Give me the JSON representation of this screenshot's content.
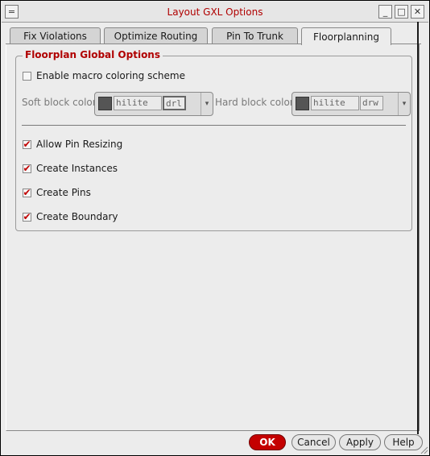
{
  "window": {
    "title": "Layout GXL Options",
    "menu_glyph": "=",
    "min_glyph": "_",
    "max_glyph": "□",
    "close_glyph": "✕"
  },
  "tabs": [
    {
      "label": "Fix Violations",
      "active": false
    },
    {
      "label": "Optimize Routing",
      "active": false
    },
    {
      "label": "Pin To Trunk",
      "active": false
    },
    {
      "label": "Floorplanning",
      "active": true
    }
  ],
  "floorplan": {
    "group_title": "Floorplan Global Options",
    "enable_macro_coloring": {
      "label": "Enable macro coloring scheme",
      "checked": false
    },
    "soft_block": {
      "label": "Soft block color",
      "layer": "hilite",
      "purpose": "drl"
    },
    "hard_block": {
      "label": "Hard block color",
      "layer": "hilite",
      "purpose": "drw"
    },
    "options": [
      {
        "label": "Allow Pin Resizing",
        "checked": true
      },
      {
        "label": "Create Instances",
        "checked": true
      },
      {
        "label": "Create Pins",
        "checked": true
      },
      {
        "label": "Create Boundary",
        "checked": true
      }
    ]
  },
  "buttons": {
    "ok": "OK",
    "cancel": "Cancel",
    "apply": "Apply",
    "help": "Help"
  },
  "colors": {
    "accent_red": "#c40000",
    "title_red": "#b00000",
    "swatch": "#555555"
  },
  "icons": {
    "check": "✔",
    "dropdown": "▾"
  }
}
